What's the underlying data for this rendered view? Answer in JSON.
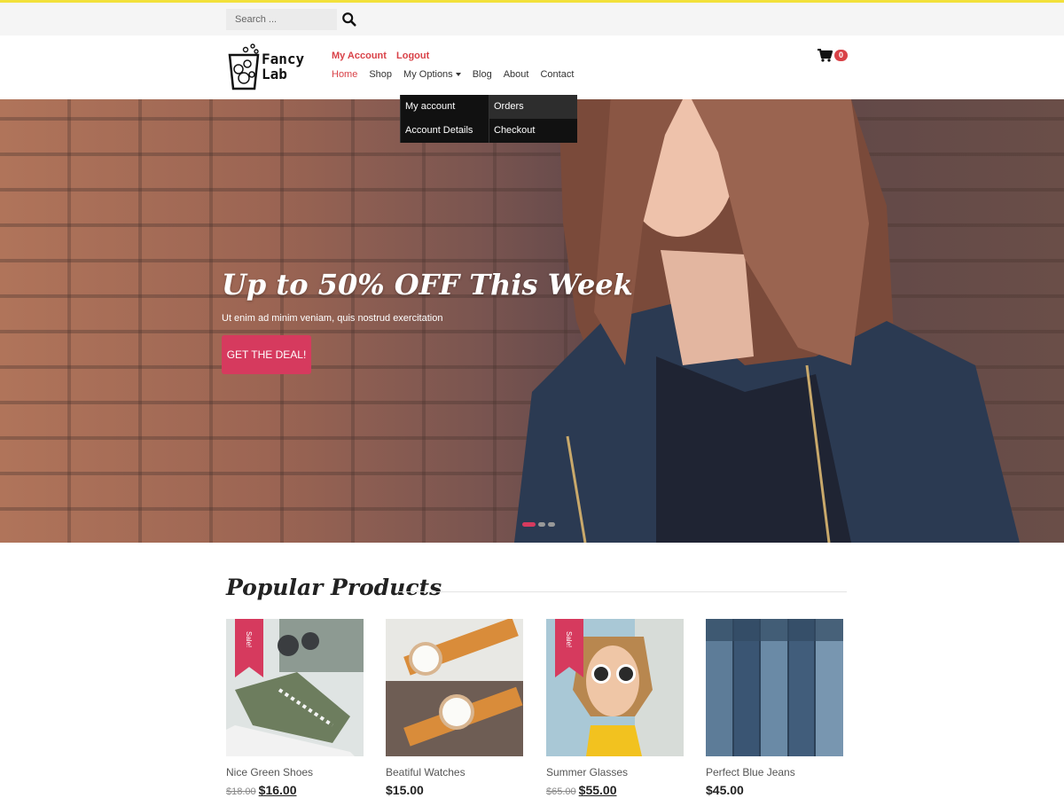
{
  "search": {
    "placeholder": "Search ..."
  },
  "brand": {
    "line1": "Fancy",
    "line2": "Lab"
  },
  "account_links": {
    "my_account": "My Account",
    "logout": "Logout"
  },
  "nav": {
    "home": "Home",
    "shop": "Shop",
    "my_options": "My Options",
    "blog": "Blog",
    "about": "About",
    "contact": "Contact"
  },
  "dropdown": {
    "my_account": "My account",
    "orders": "Orders",
    "account_details": "Account Details",
    "checkout": "Checkout"
  },
  "cart": {
    "count": "0"
  },
  "hero": {
    "title": "Up to 50% OFF This Week",
    "subtitle": "Ut enim ad minim veniam, quis nostrud exercitation",
    "button": "GET THE DEAL!"
  },
  "popular": {
    "title": "Popular Products"
  },
  "products": [
    {
      "name": "Nice Green Shoes",
      "old_price": "$18.00",
      "price": "$16.00",
      "badge": "Sale!"
    },
    {
      "name": "Beatiful Watches",
      "old_price": "",
      "price": "$15.00",
      "badge": ""
    },
    {
      "name": "Summer Glasses",
      "old_price": "$65.00",
      "price": "$55.00",
      "badge": "Sale!"
    },
    {
      "name": "Perfect Blue Jeans",
      "old_price": "",
      "price": "$45.00",
      "badge": ""
    }
  ],
  "colors": {
    "accent": "#d63a5e",
    "link_red": "#d94248",
    "top_stripe": "#f2e13a"
  }
}
